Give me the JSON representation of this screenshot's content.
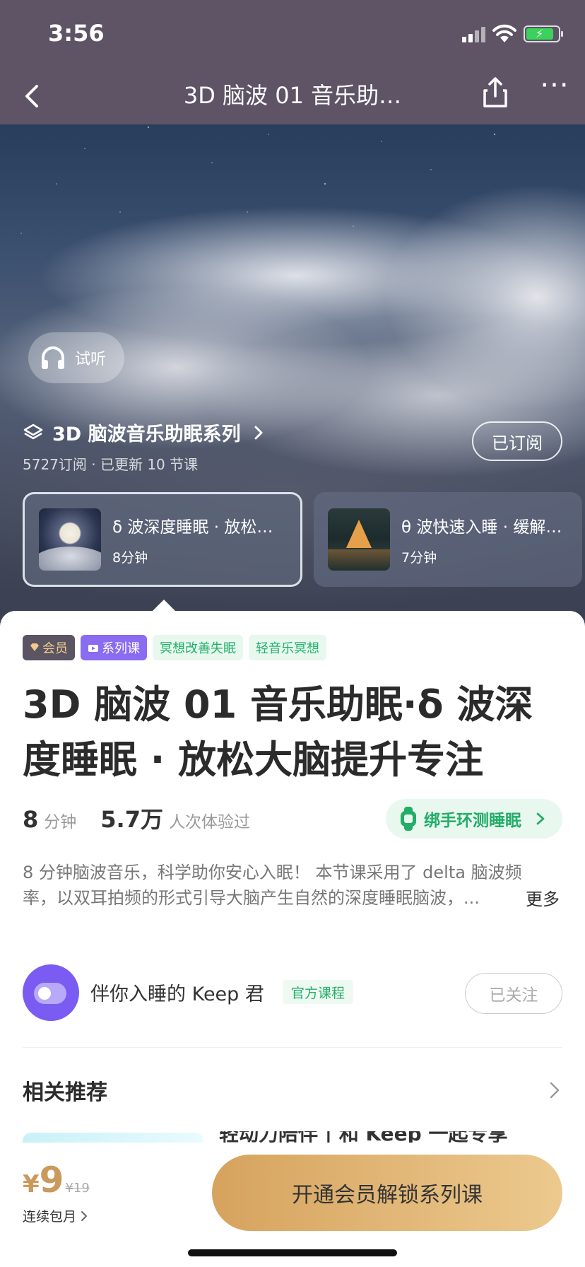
{
  "status_bar": {
    "time": "3:56",
    "battery_color": "#3ad25b"
  },
  "nav": {
    "title": "3D 脑波 01 音乐助…",
    "back_icon": "chevron-left-icon",
    "share_icon": "share-icon",
    "more_icon": "more-icon"
  },
  "hero": {
    "trial_label": "试听",
    "series_title": "3D 脑波音乐助眠系列",
    "series_meta": "5727订阅 · 已更新 10 节课",
    "subscribed_label": "已订阅",
    "episodes": [
      {
        "title": "δ 波深度睡眠 · 放松…",
        "duration": "8分钟",
        "thumb": "moon-clouds"
      },
      {
        "title": "θ 波快速入睡 · 缓解…",
        "duration": "7分钟",
        "thumb": "cabin-lake"
      }
    ]
  },
  "tags": [
    {
      "label": "会员",
      "type": "vip"
    },
    {
      "label": "系列课",
      "type": "series"
    },
    {
      "label": "冥想改善失眠",
      "type": "topic"
    },
    {
      "label": "轻音乐冥想",
      "type": "topic"
    }
  ],
  "main": {
    "title_line1": "3D 脑波 01 音乐助眠·δ 波深",
    "title_line2": "度睡眠 · 放松大脑提升专注",
    "duration_num": "8",
    "duration_unit": "分钟",
    "plays_num": "5.7万",
    "plays_unit": "人次体验过",
    "band_label": "绑手环测睡眠",
    "desc_line1": "8 分钟脑波音乐，科学助你安心入眠！ 本节课采用了 delta 脑波频",
    "desc_line2": "率，以双耳拍频的形式引导大脑产生自然的深度睡眠脑波，...",
    "more_label": "更多"
  },
  "author": {
    "name": "伴你入睡的 Keep 君",
    "badge": "官方课程",
    "follow_label": "已关注"
  },
  "recommend": {
    "title": "相关推荐",
    "peek_text": "轻动力陪伴 | 和 Keep 一起专享"
  },
  "purchase": {
    "currency": "¥",
    "price": "9",
    "original_price": "¥19",
    "plan_label": "连续包月",
    "cta_label": "开通会员解锁系列课",
    "accent_color": "#c99a5b"
  }
}
